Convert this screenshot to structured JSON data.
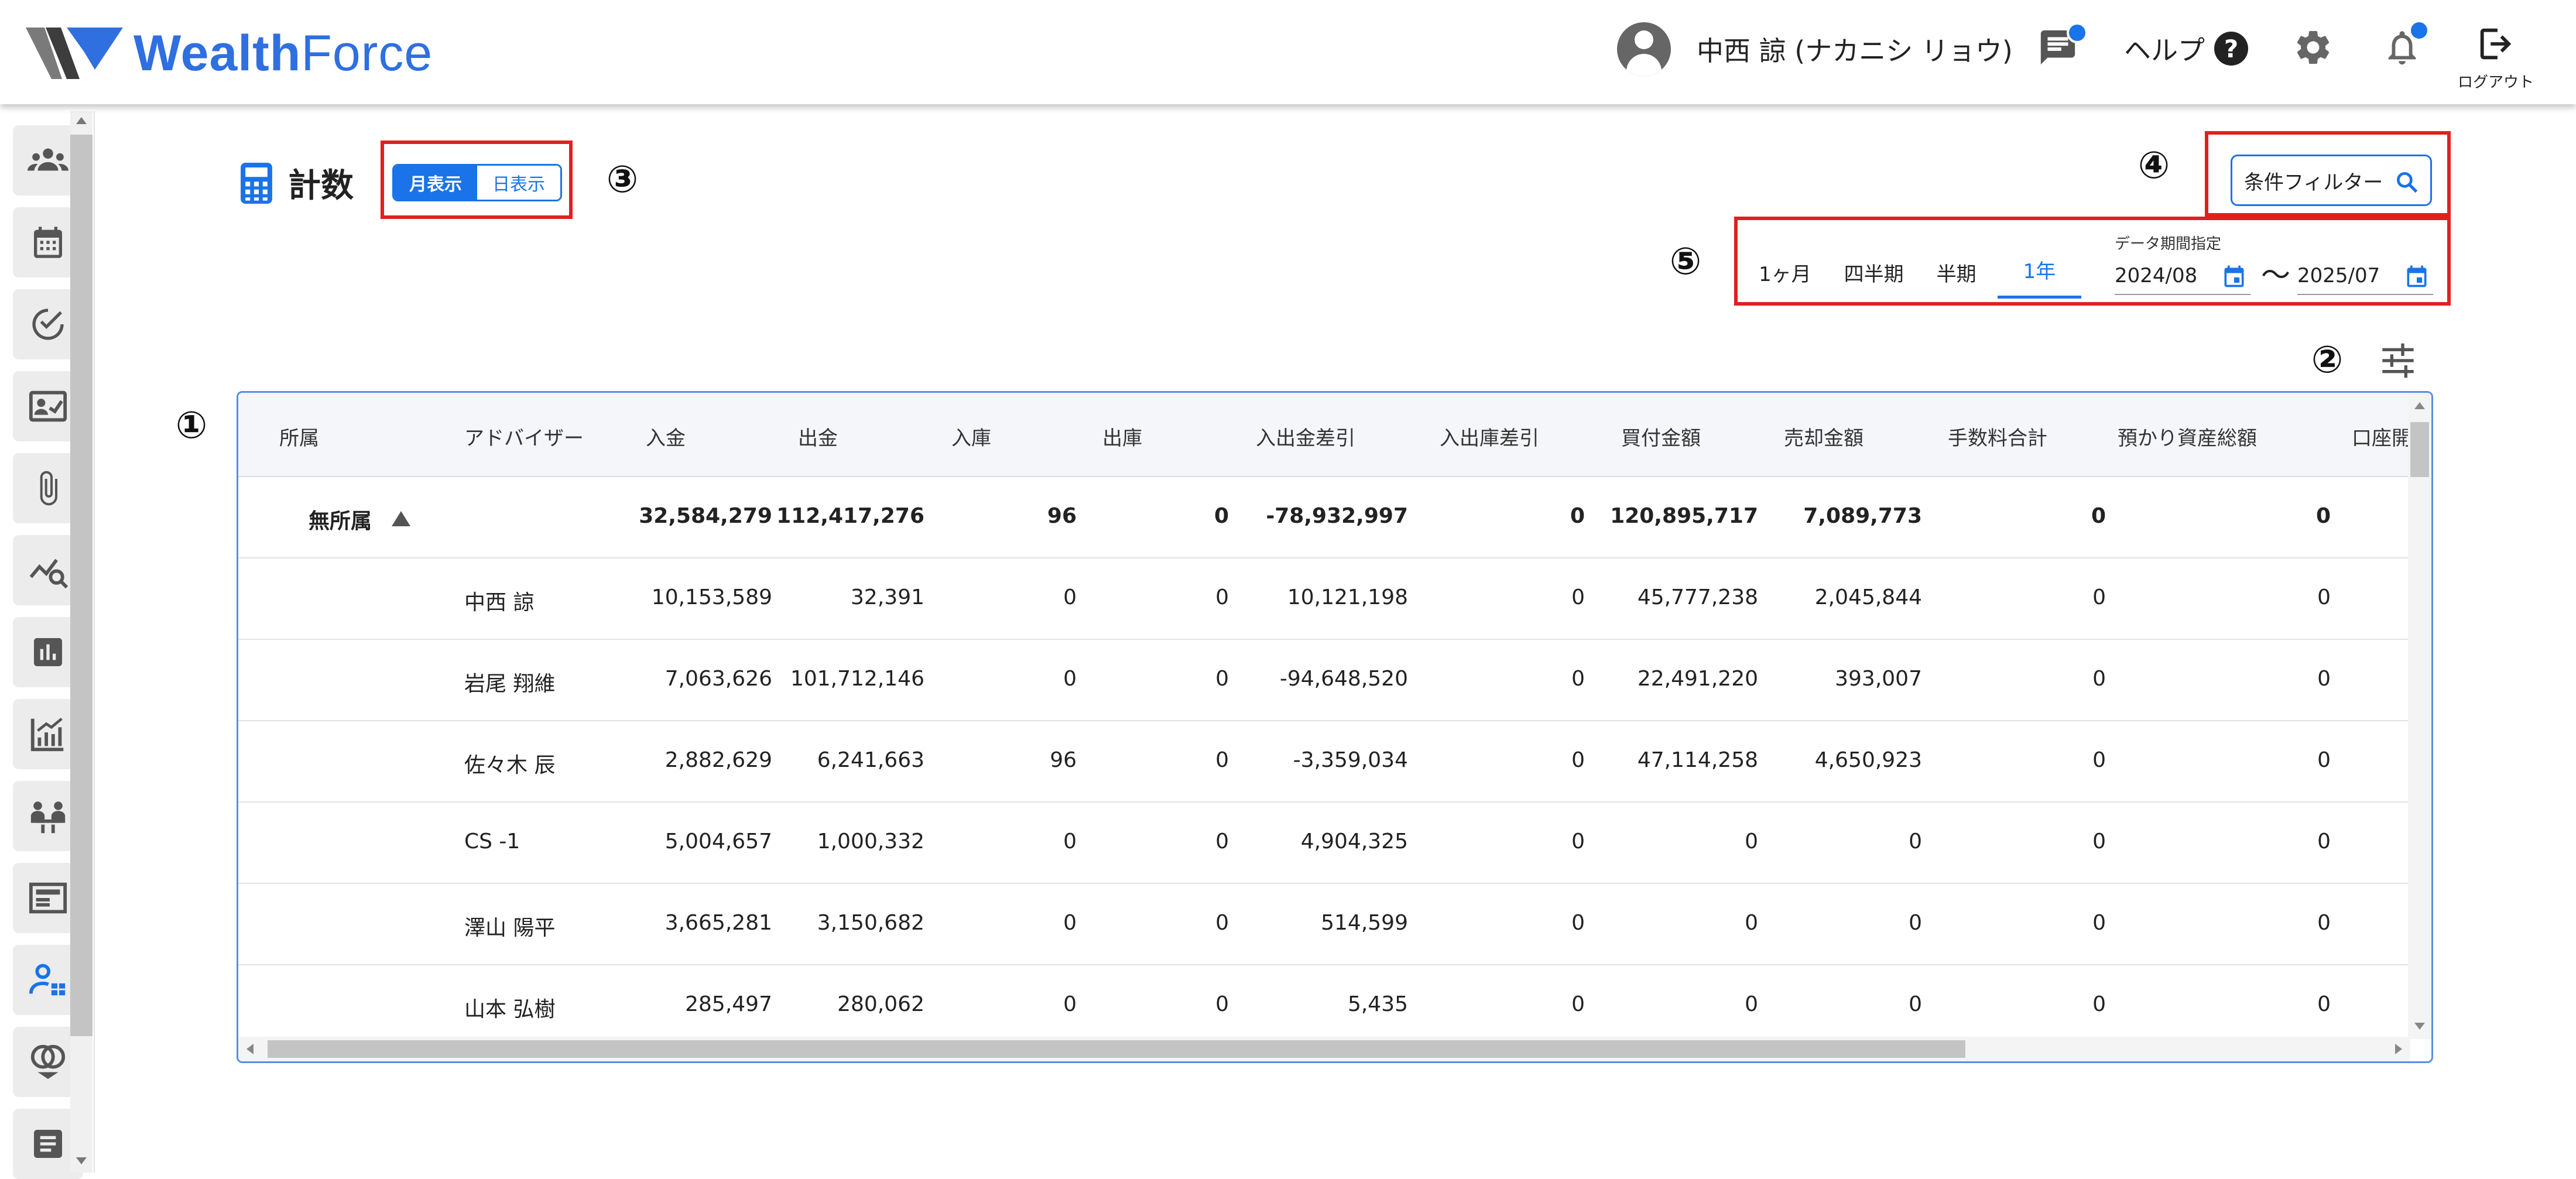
{
  "header": {
    "logo_bold": "Wealth",
    "logo_rest": "Force",
    "user_name": "中西 諒 (ナカニシ リョウ)",
    "help_label": "ヘルプ",
    "help_glyph": "?",
    "logout_label": "ログアウト",
    "accent_color": "#1a73e8"
  },
  "sidebar": {
    "icons": [
      "group-icon",
      "calendar-icon",
      "check-circle-icon",
      "id-card-icon",
      "paperclip-icon",
      "trend-search-icon",
      "bar-chart-icon",
      "growth-chart-icon",
      "meeting-icon",
      "news-icon",
      "user-management-icon",
      "rings-icon",
      "document-icon"
    ],
    "active_index": 10
  },
  "page": {
    "title": "計数",
    "toggle": {
      "month": "月表示",
      "day": "日表示"
    },
    "markers": {
      "m1": "①",
      "m2": "②",
      "m3": "③",
      "m4": "④",
      "m5": "⑤"
    },
    "filter_label": "条件フィルター",
    "periods": [
      "1ヶ月",
      "四半期",
      "半期",
      "1年"
    ],
    "selected_period": "1年",
    "range_label": "データ期間指定",
    "date_from": "2024/08",
    "date_to": "2025/07",
    "tilde": "〜"
  },
  "table": {
    "headers": [
      "所属",
      "アドバイザー",
      "入金",
      "出金",
      "入庫",
      "出庫",
      "入出金差引",
      "入出庫差引",
      "買付金額",
      "売却金額",
      "手数料合計",
      "預かり資産総額",
      "口座開"
    ],
    "group": {
      "label": "無所属",
      "values": [
        "32,584,279",
        "112,417,276",
        "96",
        "0",
        "-78,932,997",
        "0",
        "120,895,717",
        "7,089,773",
        "0",
        "0"
      ]
    },
    "rows": [
      {
        "name": "中西 諒",
        "values": [
          "10,153,589",
          "32,391",
          "0",
          "0",
          "10,121,198",
          "0",
          "45,777,238",
          "2,045,844",
          "0",
          "0"
        ]
      },
      {
        "name": "岩尾 翔維",
        "values": [
          "7,063,626",
          "101,712,146",
          "0",
          "0",
          "-94,648,520",
          "0",
          "22,491,220",
          "393,007",
          "0",
          "0"
        ]
      },
      {
        "name": "佐々木 辰",
        "values": [
          "2,882,629",
          "6,241,663",
          "96",
          "0",
          "-3,359,034",
          "0",
          "47,114,258",
          "4,650,923",
          "0",
          "0"
        ]
      },
      {
        "name": "CS -1",
        "values": [
          "5,004,657",
          "1,000,332",
          "0",
          "0",
          "4,904,325",
          "0",
          "0",
          "0",
          "0",
          "0"
        ]
      },
      {
        "name": "澤山 陽平",
        "values": [
          "3,665,281",
          "3,150,682",
          "0",
          "0",
          "514,599",
          "0",
          "0",
          "0",
          "0",
          "0"
        ]
      },
      {
        "name": "山本 弘樹",
        "values": [
          "285,497",
          "280,062",
          "0",
          "0",
          "5,435",
          "0",
          "0",
          "0",
          "0",
          "0"
        ]
      }
    ]
  }
}
